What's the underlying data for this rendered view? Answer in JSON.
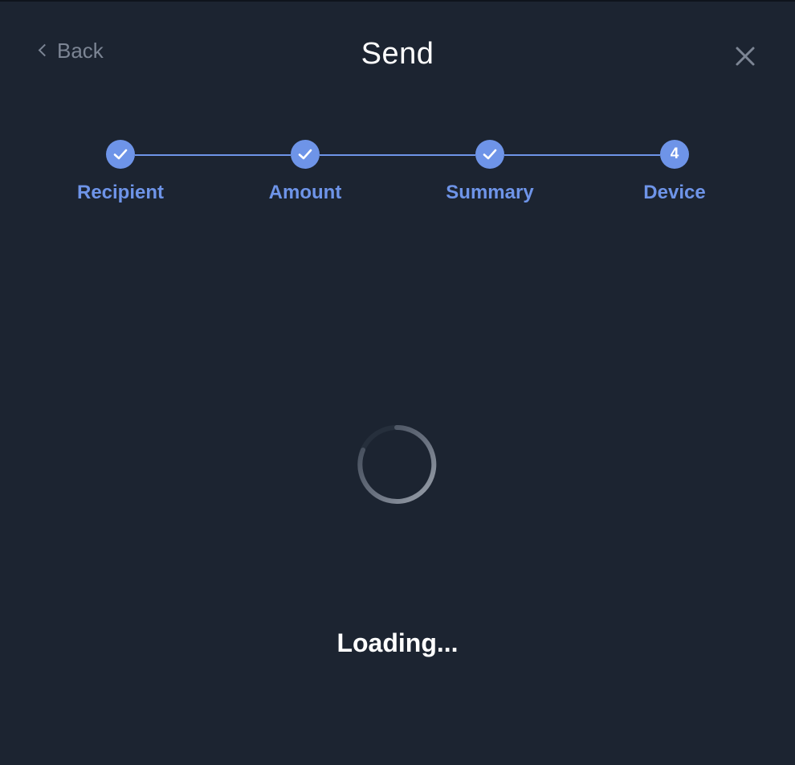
{
  "header": {
    "back_label": "Back",
    "title": "Send",
    "close_icon": "close-icon",
    "back_icon": "chevron-left-icon"
  },
  "stepper": {
    "accent_color": "#6e94e8",
    "steps": [
      {
        "label": "Recipient",
        "state": "done",
        "marker": "check-icon"
      },
      {
        "label": "Amount",
        "state": "done",
        "marker": "check-icon"
      },
      {
        "label": "Summary",
        "state": "done",
        "marker": "check-icon"
      },
      {
        "label": "Device",
        "state": "current",
        "number": "4"
      }
    ]
  },
  "main": {
    "loading_text": "Loading..."
  },
  "colors": {
    "background": "#1c2431",
    "muted_text": "#7c8594",
    "title_text": "#ffffff"
  }
}
